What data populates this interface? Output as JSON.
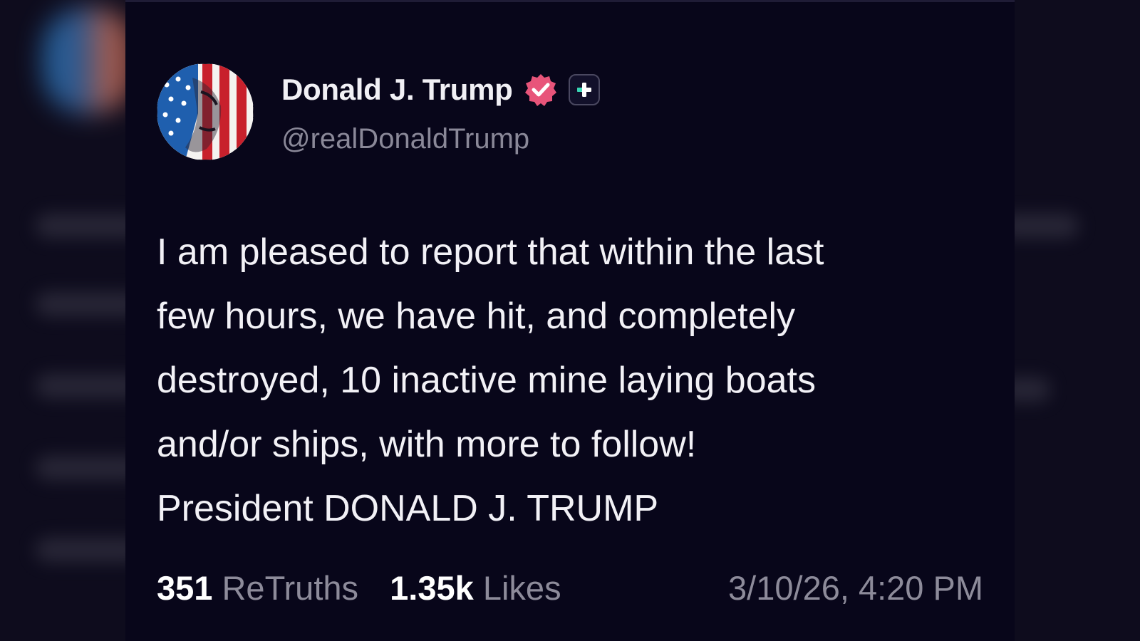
{
  "post": {
    "author": {
      "display_name": "Donald J. Trump",
      "handle": "@realDonaldTrump",
      "verified_color": "#e8547a",
      "plus_color": "#35d6b4"
    },
    "body_lines": [
      "I am pleased to report that within the last",
      "few hours, we have hit, and completely",
      "destroyed, 10 inactive mine laying boats",
      "and/or ships, with more to follow!",
      "President DONALD J. TRUMP"
    ],
    "stats": {
      "retruths_count": "351",
      "retruths_label": "ReTruths",
      "likes_count": "1.35k",
      "likes_label": "Likes",
      "timestamp": "3/10/26, 4:20 PM"
    }
  }
}
